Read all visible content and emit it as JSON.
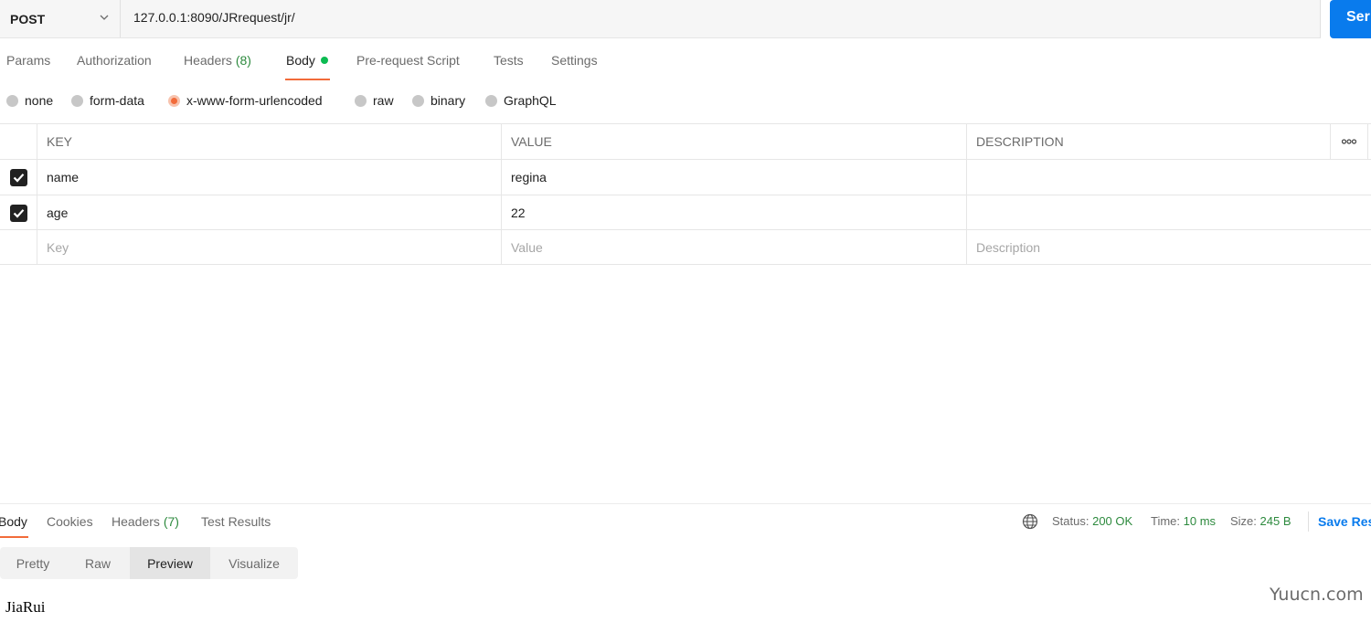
{
  "request": {
    "method": "POST",
    "url": "127.0.0.1:8090/JRrequest/jr/",
    "send_label": "Ser"
  },
  "req_tabs": {
    "params": "Params",
    "authorization": "Authorization",
    "headers": "Headers",
    "headers_count": "(8)",
    "body": "Body",
    "prerequest": "Pre-request Script",
    "tests": "Tests",
    "settings": "Settings"
  },
  "body_types": {
    "none": "none",
    "form_data": "form-data",
    "urlencoded": "x-www-form-urlencoded",
    "raw": "raw",
    "binary": "binary",
    "graphql": "GraphQL",
    "selected": "x-www-form-urlencoded"
  },
  "table": {
    "headers": {
      "key": "KEY",
      "value": "VALUE",
      "description": "DESCRIPTION",
      "more": "ooo"
    },
    "rows": [
      {
        "checked": true,
        "key": "name",
        "value": "regina",
        "description": ""
      },
      {
        "checked": true,
        "key": "age",
        "value": "22",
        "description": ""
      }
    ],
    "placeholders": {
      "key": "Key",
      "value": "Value",
      "description": "Description"
    }
  },
  "response": {
    "tabs": {
      "body": "Body",
      "cookies": "Cookies",
      "headers": "Headers",
      "headers_count": "(7)",
      "test_results": "Test Results"
    },
    "status_label": "Status:",
    "status_value": "200 OK",
    "time_label": "Time:",
    "time_value": "10 ms",
    "size_label": "Size:",
    "size_value": "245 B",
    "save_label": "Save Res",
    "views": {
      "pretty": "Pretty",
      "raw": "Raw",
      "preview": "Preview",
      "visualize": "Visualize"
    },
    "preview_content": "JiaRui"
  },
  "watermark": "Yuucn.com",
  "colors": {
    "accent_orange": "#f26b3a",
    "send_blue": "#097bed",
    "success_green": "#2d8a3e",
    "body_dot_green": "#0cbb52"
  }
}
